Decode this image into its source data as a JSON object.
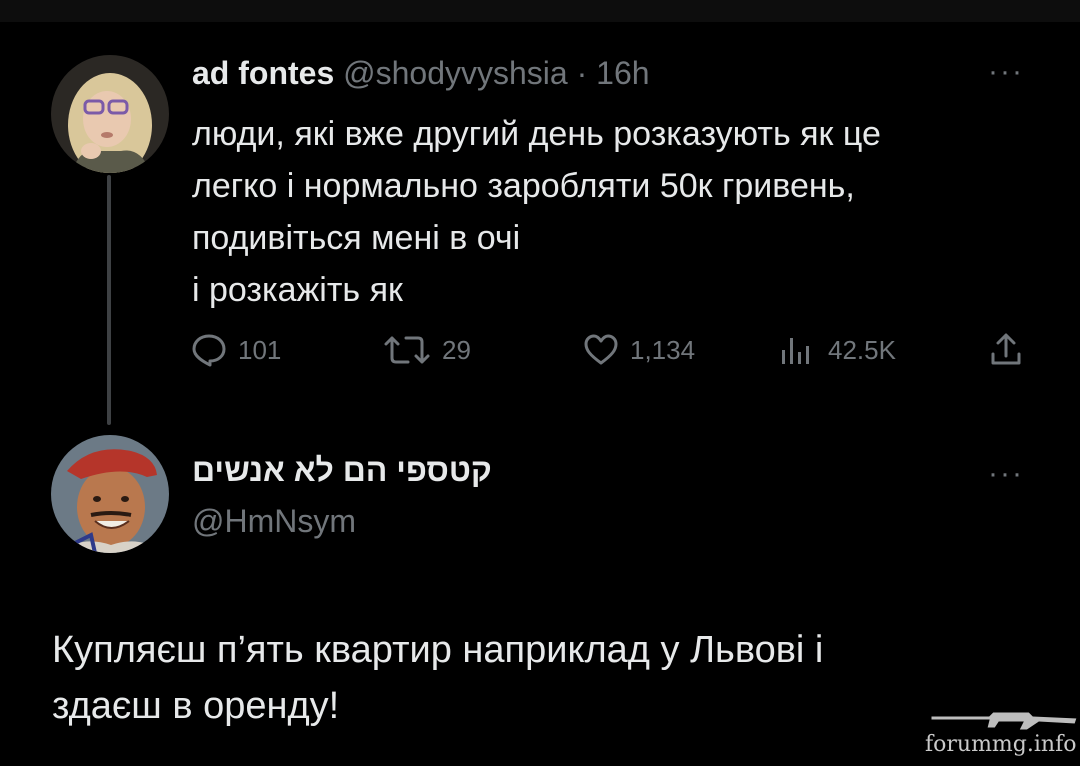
{
  "tweet1": {
    "display_name": "ad fontes",
    "handle": "@shodyvyshsia",
    "separator": "·",
    "time": "16h",
    "body_lines": [
      "люди, які вже другий день розказують як це",
      "легко і нормально заробляти 50к гривень,",
      "подивіться мені в очі",
      "і розкажіть як"
    ],
    "stats": {
      "replies": "101",
      "reposts": "29",
      "likes": "1,134",
      "views": "42.5K"
    },
    "more": "···"
  },
  "tweet2": {
    "display_name": "קטספי הם לא אנשים",
    "handle": "@HmNsym",
    "more": "···",
    "body_lines": [
      "Купляєш п’ять квартир наприклад у Львові і",
      "здаєш в оренду!"
    ]
  },
  "watermark": {
    "text": "forummg.info"
  },
  "colors": {
    "background": "#000000",
    "text_primary": "#e7e9ea",
    "text_secondary": "#71767b",
    "thread_line": "#3e4144"
  }
}
